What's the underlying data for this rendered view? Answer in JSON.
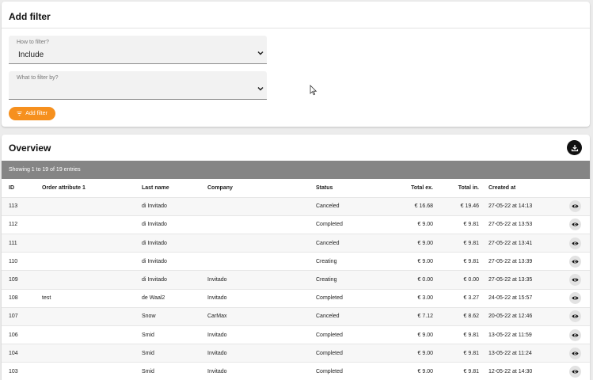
{
  "filter_panel": {
    "title": "Add filter",
    "how_label": "How to filter?",
    "how_value": "Include",
    "what_label": "What to filter by?",
    "what_value": "",
    "add_button_label": "Add filter"
  },
  "overview": {
    "title": "Overview",
    "entries_info": "Showing 1 to 19 of 19 entries",
    "columns": [
      "ID",
      "Order attribute 1",
      "Last name",
      "Company",
      "Status",
      "Total ex.",
      "Total in.",
      "Created at"
    ],
    "rows": [
      {
        "id": "113",
        "attr": "",
        "last_name": "di Invitado",
        "company": "",
        "status": "Canceled",
        "total_ex": "€ 16.68",
        "total_in": "€ 19.46",
        "created": "27-05-22 at 14:13"
      },
      {
        "id": "112",
        "attr": "",
        "last_name": "di Invitado",
        "company": "",
        "status": "Completed",
        "total_ex": "€ 9.00",
        "total_in": "€ 9.81",
        "created": "27-05-22 at 13:53"
      },
      {
        "id": "111",
        "attr": "",
        "last_name": "di Invitado",
        "company": "",
        "status": "Canceled",
        "total_ex": "€ 9.00",
        "total_in": "€ 9.81",
        "created": "27-05-22 at 13:41"
      },
      {
        "id": "110",
        "attr": "",
        "last_name": "di Invitado",
        "company": "",
        "status": "Creating",
        "total_ex": "€ 9.00",
        "total_in": "€ 9.81",
        "created": "27-05-22 at 13:39"
      },
      {
        "id": "109",
        "attr": "",
        "last_name": "di Invitado",
        "company": "Invitado",
        "status": "Creating",
        "total_ex": "€ 0.00",
        "total_in": "€ 0.00",
        "created": "27-05-22 at 13:35"
      },
      {
        "id": "108",
        "attr": "test",
        "last_name": "de Waal2",
        "company": "Invitado",
        "status": "Completed",
        "total_ex": "€ 3.00",
        "total_in": "€ 3.27",
        "created": "24-05-22 at 15:57"
      },
      {
        "id": "107",
        "attr": "",
        "last_name": "Snow",
        "company": "CarMax",
        "status": "Canceled",
        "total_ex": "€ 7.12",
        "total_in": "€ 8.62",
        "created": "20-05-22 at 12:46"
      },
      {
        "id": "106",
        "attr": "",
        "last_name": "Smid",
        "company": "Invitado",
        "status": "Completed",
        "total_ex": "€ 9.00",
        "total_in": "€ 9.81",
        "created": "13-05-22 at 11:59"
      },
      {
        "id": "104",
        "attr": "",
        "last_name": "Smid",
        "company": "Invitado",
        "status": "Completed",
        "total_ex": "€ 9.00",
        "total_in": "€ 9.81",
        "created": "13-05-22 at 11:24"
      },
      {
        "id": "103",
        "attr": "",
        "last_name": "Smid",
        "company": "Invitado",
        "status": "Completed",
        "total_ex": "€ 9.00",
        "total_in": "€ 9.81",
        "created": "12-05-22 at 14:30"
      }
    ]
  },
  "colors": {
    "accent": "#f6901e",
    "header_bar": "#858585",
    "export_button": "#111111"
  },
  "icons": {
    "add_filter": "filter-list-icon",
    "export": "download-icon",
    "row_action": "eye-icon",
    "select": "chevron-down-icon"
  }
}
